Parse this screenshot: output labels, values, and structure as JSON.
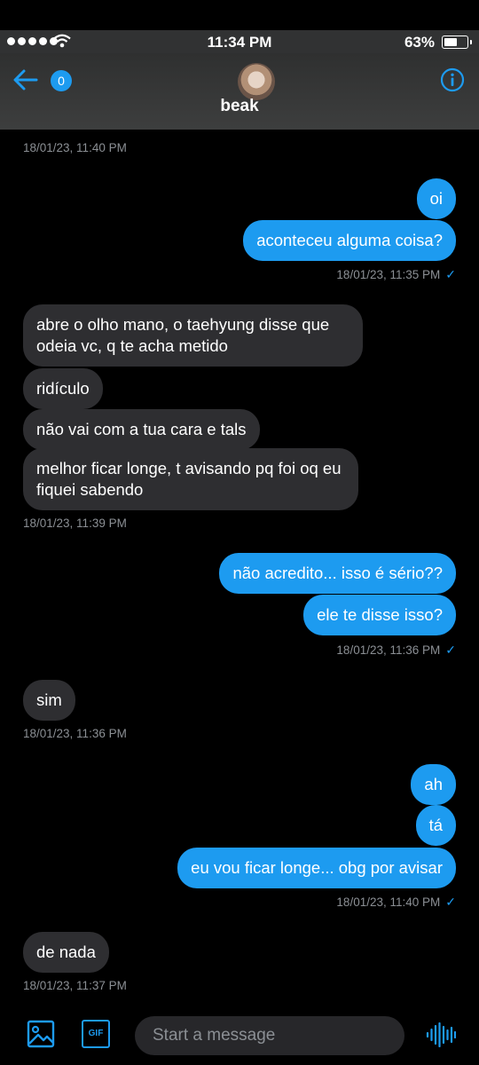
{
  "status": {
    "time": "11:34 PM",
    "battery": "63%",
    "battery_level": 0.63
  },
  "header": {
    "unread_count": "0",
    "name": "beak"
  },
  "messages": [
    {
      "type": "time",
      "text": "18/01/23, 11:40 PM"
    },
    {
      "type": "sent",
      "text": "oi"
    },
    {
      "type": "sent",
      "text": "aconteceu alguma coisa?"
    },
    {
      "type": "time",
      "text": "18/01/23, 11:35 PM",
      "read": true
    },
    {
      "type": "recv",
      "text": "abre o olho mano, o taehyung disse que odeia vc, q te acha metido"
    },
    {
      "type": "recv",
      "text": "ridículo"
    },
    {
      "type": "recv",
      "text": "não vai com a tua cara e tals"
    },
    {
      "type": "recv",
      "text": "melhor ficar longe,  t avisando pq foi oq eu fiquei sabendo"
    },
    {
      "type": "time",
      "text": "18/01/23, 11:39 PM"
    },
    {
      "type": "sent",
      "text": "não acredito... isso é sério??"
    },
    {
      "type": "sent",
      "text": "ele te disse isso?"
    },
    {
      "type": "time",
      "text": "18/01/23, 11:36 PM",
      "read": true
    },
    {
      "type": "recv",
      "text": "sim"
    },
    {
      "type": "time",
      "text": "18/01/23, 11:36 PM"
    },
    {
      "type": "sent",
      "text": "ah"
    },
    {
      "type": "sent",
      "text": "tá"
    },
    {
      "type": "sent",
      "text": "eu vou ficar longe... obg por avisar"
    },
    {
      "type": "time",
      "text": "18/01/23, 11:40 PM",
      "read": true
    },
    {
      "type": "recv",
      "text": "de nada"
    },
    {
      "type": "time",
      "text": "18/01/23, 11:37 PM"
    }
  ],
  "composer": {
    "placeholder": "Start a message",
    "gif_label": "GIF"
  },
  "colors": {
    "accent": "#1d9bf0",
    "received_bubble": "#2e2e31",
    "background": "#000000"
  }
}
